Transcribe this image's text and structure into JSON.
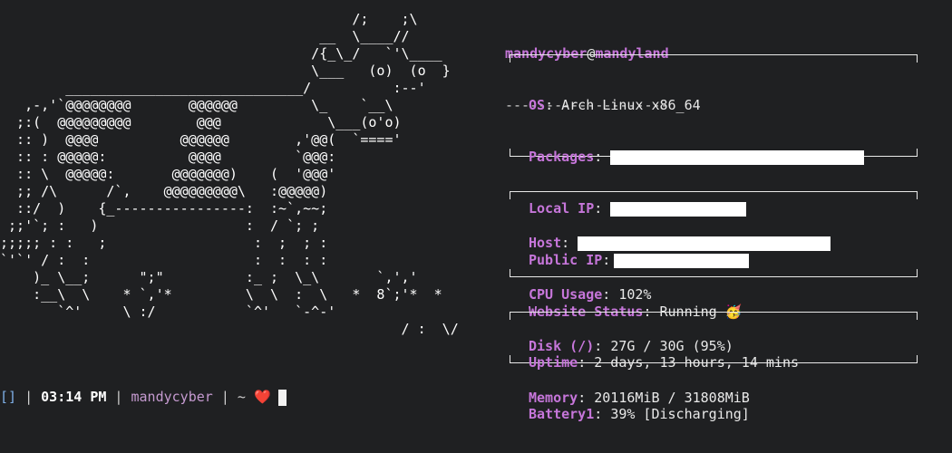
{
  "ascii_art": "                                           /;    ;\\\n                                       __  \\____//\n                                      /{_\\_/   `'\\____\n                                      \\___   (o)  (o  }\n        _____________________________/          :--'\n   ,-,'`@@@@@@@@       @@@@@@         \\_    `__\\\n  ;:(  @@@@@@@@@        @@@             \\___(o'o)\n  :: )  @@@@          @@@@@@        ,'@@(  `====' \n  :: : @@@@@:          @@@@         `@@@:\n  :: \\  @@@@@:       @@@@@@@)    (  '@@@'\n  ;; /\\      /`,    @@@@@@@@@\\   :@@@@@)\n  ::/  )    {_----------------:  :~`,~~;\n ;;'`; :   )                  :  / `; ;\n;;;;; : :   ;                  :  ;  ; :\n`'`' / :  :                    :  :  : :\n    )_ \\__;      \";\"          :_ ;  \\_\\       `,','\n    :__\\  \\    * `,'*         \\  \\  :  \\   *  8`;'*  *\n       `^'     \\ :/           `^'   `-^-'\n                                                 / :  \\/",
  "header": {
    "user": "mandycyber",
    "at": "@",
    "host": "mandyland",
    "underline": "--------------------"
  },
  "box1": {
    "rows": [
      {
        "key": "OS",
        "value": "Arch Linux x86_64"
      },
      {
        "key": "Packages",
        "value": ""
      },
      {
        "key": "Local IP",
        "value": ""
      },
      {
        "key": "Public IP",
        "value": ""
      },
      {
        "key": "Website Status",
        "value": "Running 🥳"
      }
    ]
  },
  "box2": {
    "rows": [
      {
        "key": "Host",
        "value": ""
      },
      {
        "key": "CPU Usage",
        "value": "102%"
      },
      {
        "key": "Disk (/)",
        "value": "27G / 30G (95%)"
      },
      {
        "key": "Memory",
        "value": "20116MiB / 31808MiB"
      }
    ]
  },
  "box3": {
    "rows": [
      {
        "key": "Uptime",
        "value": "2 days, 13 hours, 14 mins"
      },
      {
        "key": "Battery1",
        "value": "39% [Discharging]"
      }
    ]
  },
  "prompt": {
    "bracket": "[]",
    "sep": " | ",
    "time": "03:14 PM",
    "user": "mandycyber",
    "dir": "~",
    "heart": "❤️"
  },
  "colors": {
    "background": "#1f2022",
    "accent": "#c676da",
    "text": "#e9e9e9"
  }
}
